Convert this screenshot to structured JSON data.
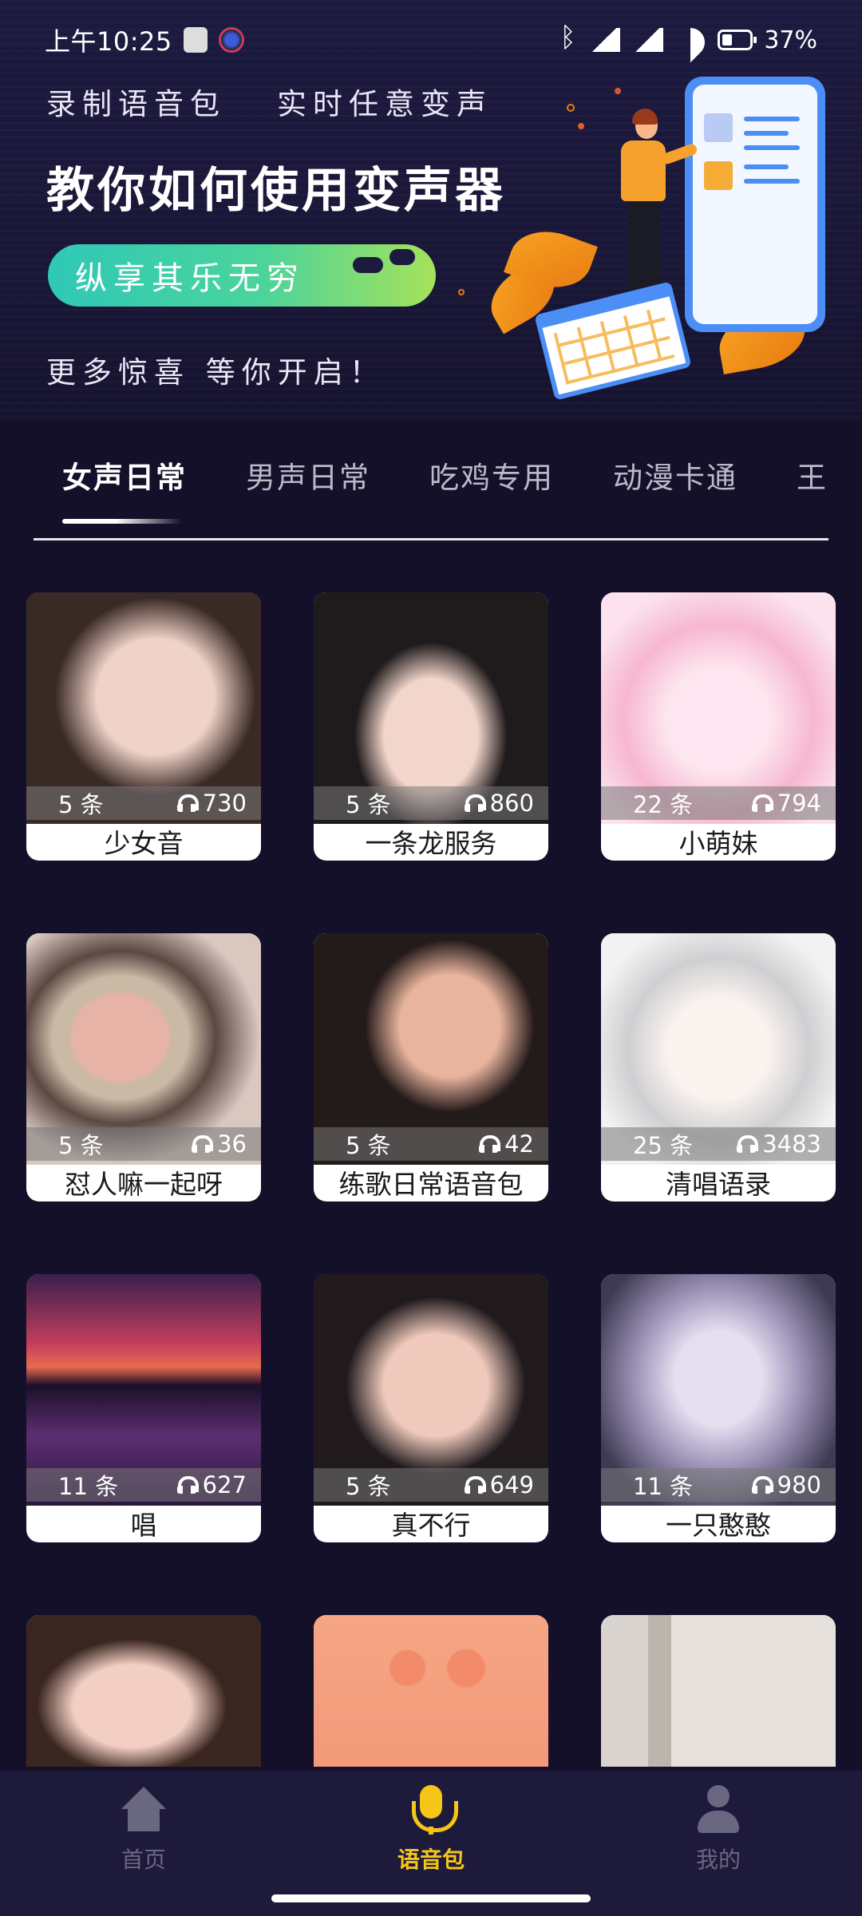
{
  "status_bar": {
    "time": "上午10:25",
    "battery": "37%",
    "icons": [
      "note-icon",
      "app-badge-icon",
      "bluetooth-icon",
      "signal-icon",
      "signal-icon",
      "wifi-icon",
      "battery-icon"
    ]
  },
  "banner": {
    "line1_left": "录制语音包",
    "line1_right": "实时任意变声",
    "title": "教你如何使用变声器",
    "pill_text": "纵享其乐无穷",
    "line3": "更多惊喜 等你开启！"
  },
  "tabs": [
    {
      "label": "女声日常",
      "active": true
    },
    {
      "label": "男声日常",
      "active": false
    },
    {
      "label": "吃鸡专用",
      "active": false
    },
    {
      "label": "动漫卡通",
      "active": false
    },
    {
      "label": "王",
      "active": false
    }
  ],
  "cards": [
    {
      "name": "少女音",
      "count": "5 条",
      "plays": "730"
    },
    {
      "name": "一条龙服务",
      "count": "5 条",
      "plays": "860"
    },
    {
      "name": "小萌妹",
      "count": "22 条",
      "plays": "794"
    },
    {
      "name": "怼人嘛一起呀",
      "count": "5 条",
      "plays": "36"
    },
    {
      "name": "练歌日常语音包",
      "count": "5 条",
      "plays": "42"
    },
    {
      "name": "清唱语录",
      "count": "25 条",
      "plays": "3483"
    },
    {
      "name": "唱",
      "count": "11 条",
      "plays": "627"
    },
    {
      "name": "真不行",
      "count": "5 条",
      "plays": "649"
    },
    {
      "name": "一只憨憨",
      "count": "11 条",
      "plays": "980"
    }
  ],
  "bottom_nav": [
    {
      "label": "首页",
      "icon": "home-icon",
      "active": false
    },
    {
      "label": "语音包",
      "icon": "microphone-icon",
      "active": true
    },
    {
      "label": "我的",
      "icon": "user-icon",
      "active": false
    }
  ],
  "colors": {
    "background": "#141029",
    "nav_background": "#1e1a3c",
    "accent": "#f5c518",
    "pill_gradient_start": "#2fc8b8",
    "pill_gradient_end": "#a5e25a"
  }
}
